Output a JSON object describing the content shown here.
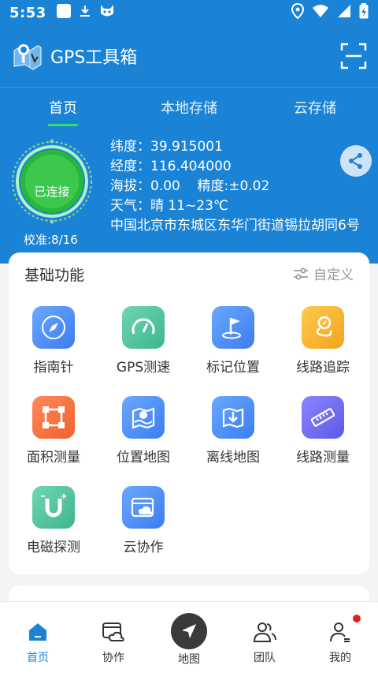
{
  "status_bar": {
    "time": "5:53",
    "left_icons": [
      "square-notification-icon",
      "download-icon",
      "cat-face-icon"
    ],
    "right_icons": [
      "location-icon",
      "wifi-icon",
      "signal-icon",
      "battery-icon"
    ]
  },
  "app_bar": {
    "title": "GPS工具箱",
    "icons": [
      "app-logo",
      "scan-icon"
    ]
  },
  "tabs": [
    {
      "label": "首页",
      "active": true
    },
    {
      "label": "本地存储",
      "active": false
    },
    {
      "label": "云存储",
      "active": false
    }
  ],
  "gps_status": {
    "connection": "已连接",
    "calibration": "校准:8/16",
    "latitude": "纬度：39.915001",
    "longitude": "经度：116.404000",
    "altitude_accuracy": "海拔：0.00    精度:±0.02",
    "weather": "天气：晴 11~23℃",
    "address": "中国北京市东城区东华门街道锡拉胡同6号"
  },
  "basic_functions": {
    "title": "基础功能",
    "custom_label": "自定义",
    "items": [
      {
        "label": "指南针",
        "icon": "compass-icon"
      },
      {
        "label": "GPS测速",
        "icon": "speedometer-icon"
      },
      {
        "label": "标记位置",
        "icon": "flag-icon"
      },
      {
        "label": "线路追踪",
        "icon": "route-track-icon"
      },
      {
        "label": "面积测量",
        "icon": "area-measure-icon"
      },
      {
        "label": "位置地图",
        "icon": "location-map-icon"
      },
      {
        "label": "离线地图",
        "icon": "offline-map-icon"
      },
      {
        "label": "线路测量",
        "icon": "ruler-icon"
      },
      {
        "label": "电磁探测",
        "icon": "magnet-icon"
      },
      {
        "label": "云协作",
        "icon": "cloud-collab-icon"
      }
    ]
  },
  "bottom_nav": [
    {
      "label": "首页",
      "icon": "home-icon",
      "active": true
    },
    {
      "label": "协作",
      "icon": "collab-icon",
      "active": false
    },
    {
      "label": "地图",
      "icon": "navigation-arrow-icon",
      "active": false
    },
    {
      "label": "团队",
      "icon": "team-icon",
      "active": false
    },
    {
      "label": "我的",
      "icon": "profile-icon",
      "active": false,
      "badge": true
    }
  ],
  "colors": {
    "primary": "#1a83d6",
    "tab_indicator": "#35e06a",
    "ring_green": "#27b83a",
    "badge_red": "#e02020"
  }
}
